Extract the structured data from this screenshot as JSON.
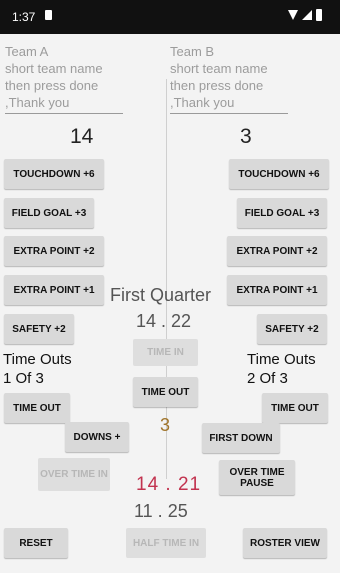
{
  "status": {
    "time": "1:37"
  },
  "team_a": {
    "placeholder": "Team A\nshort team name\nthen press done\n,Thank you",
    "score": "14",
    "buttons": {
      "touchdown": "TOUCHDOWN +6",
      "field_goal": "FIELD GOAL +3",
      "extra_point_2": "EXTRA POINT +2",
      "extra_point_1": "EXTRA POINT +1",
      "safety": "SAFETY +2",
      "time_out": "TIME OUT"
    },
    "time_outs_label": "Time Outs",
    "time_outs_count": "1 Of 3"
  },
  "team_b": {
    "placeholder": "Team B\nshort team name\nthen press done\n,Thank you",
    "score": "3",
    "buttons": {
      "touchdown": "TOUCHDOWN +6",
      "field_goal": "FIELD GOAL +3",
      "extra_point_2": "EXTRA POINT +2",
      "extra_point_1": "EXTRA POINT +1",
      "safety": "SAFETY +2",
      "time_out": "TIME OUT"
    },
    "time_outs_label": "Time Outs",
    "time_outs_count": "2 Of 3"
  },
  "center": {
    "quarter": "First Quarter",
    "game_clock": "14 . 22",
    "time_in": "TIME IN",
    "time_out": "TIME OUT",
    "quarter_number": "3",
    "downs": "DOWNS +",
    "first_down": "FIRST DOWN",
    "over_time_in": "OVER TIME IN",
    "over_time_pause": "OVER TIME PAUSE",
    "overtime_clock": "14 . 21",
    "secondary_clock": "11 . 25"
  },
  "footer": {
    "reset": "RESET",
    "half_time_in": "HALF TIME IN",
    "roster_view": "ROSTER VIEW"
  }
}
